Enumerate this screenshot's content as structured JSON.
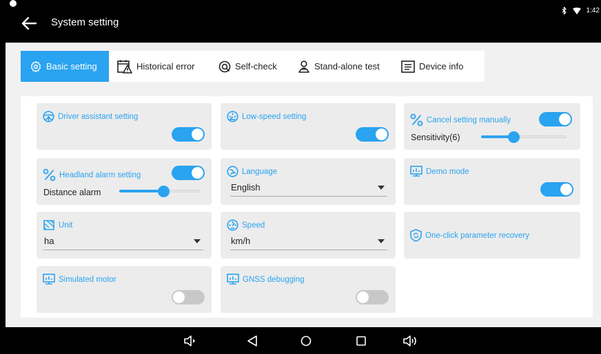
{
  "app": {
    "title": "System setting",
    "time": "1:42"
  },
  "colors": {
    "accent": "#2aa3f0",
    "card": "#ececec",
    "toggle_off": "#c8c8c8"
  },
  "tabs": [
    {
      "label": "Basic setting",
      "icon": "gear-icon",
      "active": true
    },
    {
      "label": "Historical error",
      "icon": "error-history-icon",
      "active": false
    },
    {
      "label": "Self-check",
      "icon": "self-check-icon",
      "active": false
    },
    {
      "label": "Stand-alone test",
      "icon": "person-test-icon",
      "active": false
    },
    {
      "label": "Device info",
      "icon": "device-info-icon",
      "active": false
    }
  ],
  "cards": {
    "driver_assistant": {
      "title": "Driver assistant setting",
      "enabled": true
    },
    "low_speed": {
      "title": "Low-speed setting",
      "enabled": true
    },
    "cancel_manual": {
      "title": "Cancel setting manually",
      "enabled": true,
      "slider_label": "Sensitivity(6)",
      "slider_fraction": 0.38
    },
    "headland_alarm": {
      "title": "Headland alarm setting",
      "enabled": true,
      "slider_label": "Distance alarm",
      "slider_fraction": 0.55
    },
    "language": {
      "title": "Language",
      "value": "English"
    },
    "demo_mode": {
      "title": "Demo mode",
      "enabled": true
    },
    "unit": {
      "title": "Unit",
      "value": "ha"
    },
    "speed": {
      "title": "Speed",
      "value": "km/h"
    },
    "param_recovery": {
      "title": "One-click parameter recovery"
    },
    "simulated_motor": {
      "title": "Simulated motor",
      "enabled": false
    },
    "gnss_debugging": {
      "title": "GNSS debugging",
      "enabled": false
    }
  },
  "nav": [
    "volume-down-icon",
    "back-icon",
    "home-icon",
    "recents-icon",
    "volume-up-icon"
  ]
}
